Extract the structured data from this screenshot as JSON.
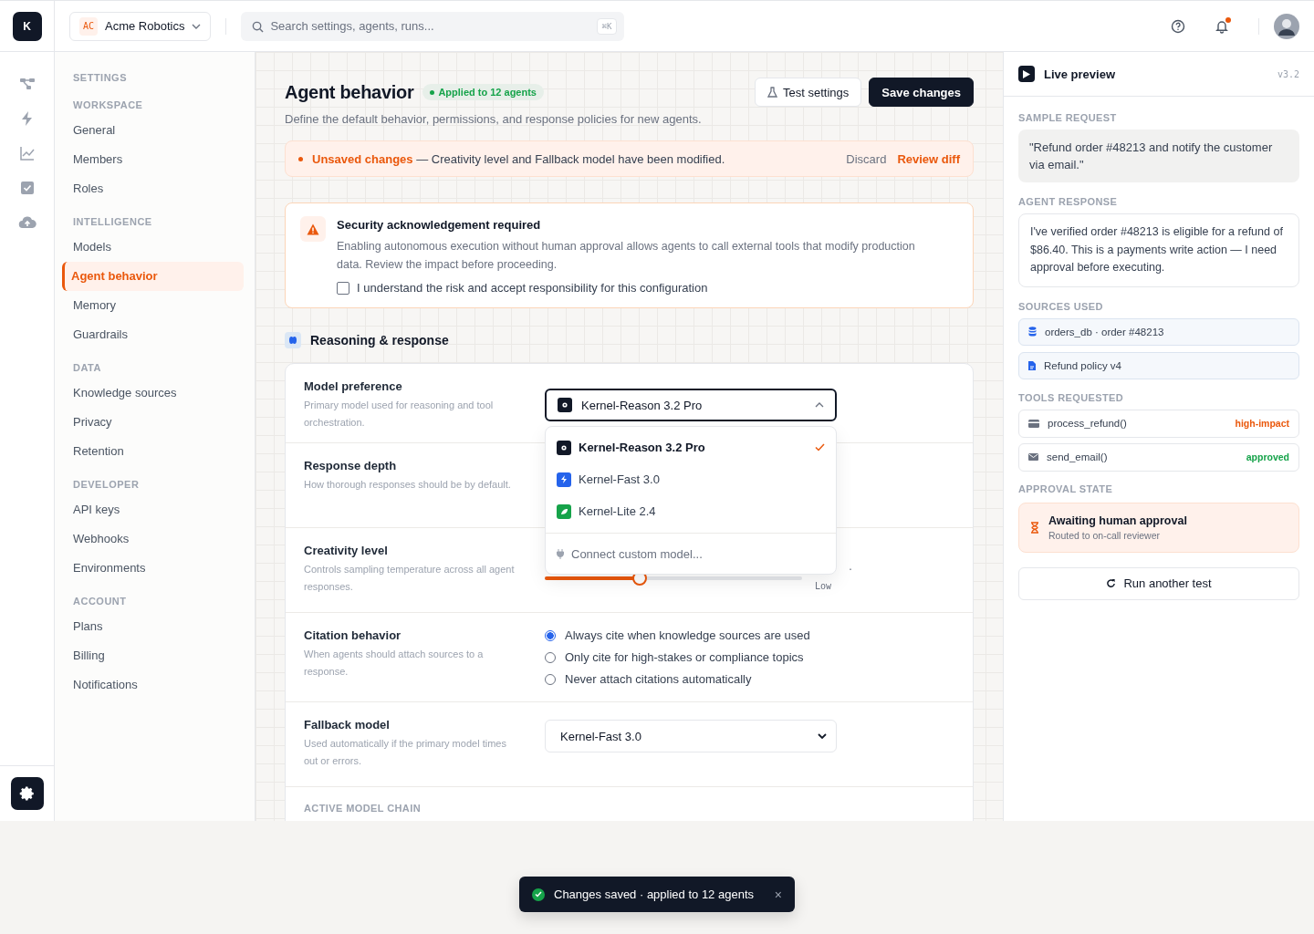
{
  "topbar": {
    "logo": "K",
    "workspace": {
      "badge": "AC",
      "name": "Acme Robotics"
    },
    "search": {
      "placeholder": "Search settings, agents, runs...",
      "shortcut": "⌘K"
    },
    "notifications_unread": true
  },
  "rail": [
    {
      "kind": "flow",
      "selected": false
    },
    {
      "kind": "bolt",
      "selected": false
    },
    {
      "kind": "chart",
      "selected": false
    },
    {
      "kind": "check",
      "selected": false
    },
    {
      "kind": "cloud",
      "selected": false
    }
  ],
  "nav": {
    "heading": "SETTINGS",
    "sections": [
      {
        "title": "WORKSPACE",
        "items": [
          {
            "label": "General",
            "selected": false
          },
          {
            "label": "Members",
            "selected": false
          },
          {
            "label": "Roles",
            "selected": false
          }
        ]
      },
      {
        "title": "INTELLIGENCE",
        "items": [
          {
            "label": "Models",
            "selected": false
          },
          {
            "label": "Agent behavior",
            "selected": true
          },
          {
            "label": "Memory",
            "selected": false
          },
          {
            "label": "Guardrails",
            "selected": false
          }
        ]
      },
      {
        "title": "DATA",
        "items": [
          {
            "label": "Knowledge sources",
            "selected": false
          },
          {
            "label": "Privacy",
            "selected": false
          },
          {
            "label": "Retention",
            "selected": false
          }
        ]
      },
      {
        "title": "DEVELOPER",
        "items": [
          {
            "label": "API keys",
            "selected": false
          },
          {
            "label": "Webhooks",
            "selected": false
          },
          {
            "label": "Environments",
            "selected": false
          }
        ]
      },
      {
        "title": "ACCOUNT",
        "items": [
          {
            "label": "Plans",
            "selected": false
          },
          {
            "label": "Billing",
            "selected": false
          },
          {
            "label": "Notifications",
            "selected": false
          }
        ]
      }
    ]
  },
  "page": {
    "title": "Agent behavior",
    "badge": "Applied to 12 agents",
    "subtitle": "Define the default behavior, permissions, and response policies for new agents.",
    "buttons": [
      {
        "label": "Test settings",
        "kind": "secondary"
      },
      {
        "label": "Save changes",
        "kind": "primary"
      }
    ]
  },
  "alert": {
    "text": "**Unsaved changes** — Creativity level and Fallback model have been modified.",
    "actions": [
      {
        "label": "Discard",
        "kind": "muted"
      },
      {
        "label": "Review diff",
        "kind": "accent"
      }
    ]
  },
  "security": {
    "title": "Security acknowledgement required",
    "text": "Enabling autonomous execution without human approval allows agents to call external tools that modify production data. Review the impact before proceeding.",
    "checkbox": {
      "label": "I understand the risk and accept responsibility for this configuration",
      "checked": false
    }
  },
  "section": {
    "title": "Reasoning & response"
  },
  "rows": [
    {
      "kind": "select",
      "label": "Model preference",
      "hint": "Primary model used for reasoning and tool orchestration.",
      "value": "Kernel-Reason 3.2 Pro",
      "expanded": true,
      "options": [
        {
          "label": "Kernel-Reason 3.2 Pro",
          "selected": true
        },
        {
          "label": "Kernel-Fast 3.0",
          "selected": false
        },
        {
          "label": "Kernel-Lite 2.4",
          "selected": false
        }
      ],
      "footer": "Connect custom model..."
    },
    {
      "kind": "hidden",
      "label": "Response depth",
      "hint": "How thorough responses should be by default."
    },
    {
      "kind": "slider",
      "label": "Creativity level",
      "hint": "Controls sampling temperature across all agent responses.",
      "level": 0.37,
      "reading": "·",
      "reading_note": "Low"
    },
    {
      "kind": "radio",
      "label": "Citation behavior",
      "hint": "When agents should attach sources to a response.",
      "options": [
        {
          "label": "Always cite when knowledge sources are used",
          "selected": true
        },
        {
          "label": "Only cite for high-stakes or compliance topics",
          "selected": false
        },
        {
          "label": "Never attach citations automatically",
          "selected": false
        }
      ]
    },
    {
      "kind": "native",
      "label": "Fallback model",
      "hint": "Used automatically if the primary model times out or errors.",
      "value": "Kernel-Fast 3.0"
    },
    {
      "kind": "heading",
      "label": "ACTIVE MODEL CHAIN"
    }
  ],
  "preview": {
    "title": "Live preview",
    "version": "v3.2",
    "request": {
      "heading": "SAMPLE REQUEST",
      "text": "\"Refund order #48213 and notify the customer via email.\""
    },
    "response": {
      "heading": "AGENT RESPONSE",
      "text": "I've verified order #48213 is eligible for a refund of $86.40. This is a payments write action — I need approval before executing."
    },
    "sources": {
      "heading": "SOURCES USED",
      "items": [
        {
          "label": "orders_db · order #48213"
        },
        {
          "label": "Refund policy v4"
        }
      ]
    },
    "tools": {
      "heading": "TOOLS REQUESTED",
      "items": [
        {
          "label": "process_refund()",
          "status": "high-impact",
          "color": "#ea580c"
        },
        {
          "label": "send_email()",
          "status": "approved",
          "color": "#16a34a"
        }
      ]
    },
    "approval": {
      "heading": "APPROVAL STATE",
      "title": "Awaiting human approval",
      "text": "Routed to on-call reviewer"
    },
    "button": "Run another test"
  },
  "toast": {
    "text": "Changes saved · applied to 12 agents",
    "close": "×"
  }
}
